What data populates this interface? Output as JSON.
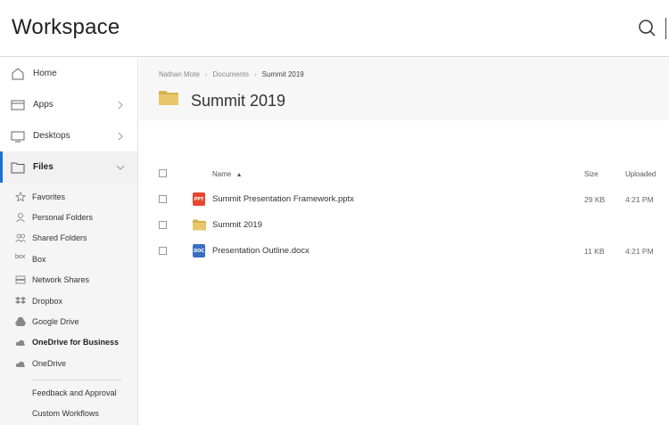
{
  "header": {
    "title": "Workspace"
  },
  "sidebar": {
    "items": [
      {
        "label": "Home",
        "icon": "home-icon"
      },
      {
        "label": "Apps",
        "icon": "apps-icon"
      },
      {
        "label": "Desktops",
        "icon": "desktop-icon"
      },
      {
        "label": "Files",
        "icon": "folder-icon"
      }
    ],
    "sub_items": [
      {
        "label": "Favorites",
        "icon": "star-icon"
      },
      {
        "label": "Personal Folders",
        "icon": "person-icon"
      },
      {
        "label": "Shared Folders",
        "icon": "people-icon"
      },
      {
        "label": "Box",
        "icon": "box-icon",
        "icon_text": "box"
      },
      {
        "label": "Network Shares",
        "icon": "server-icon"
      },
      {
        "label": "Dropbox",
        "icon": "dropbox-icon"
      },
      {
        "label": "Google Drive",
        "icon": "google-drive-icon"
      },
      {
        "label": "OneDrive for Business",
        "icon": "cloud-icon"
      },
      {
        "label": "OneDrive",
        "icon": "cloud-icon"
      },
      {
        "label": "Feedback and Approval"
      },
      {
        "label": "Custom Workflows"
      }
    ]
  },
  "main": {
    "breadcrumb": [
      "Nathan Mote",
      "Documents",
      "Summit 2019"
    ],
    "title": "Summit 2019",
    "table": {
      "columns": {
        "name": "Name",
        "size": "Size",
        "uploaded": "Uploaded"
      },
      "rows": [
        {
          "type": "pptx",
          "badge": "PPT",
          "name": "Summit Presentation Framework.pptx",
          "size": "29 KB",
          "uploaded": "4:21 PM"
        },
        {
          "type": "folder",
          "badge": "",
          "name": "Summit 2019",
          "size": "",
          "uploaded": ""
        },
        {
          "type": "docx",
          "badge": "DOC",
          "name": "Presentation Outline.docx",
          "size": "11 KB",
          "uploaded": "4:21 PM"
        }
      ]
    }
  },
  "colors": {
    "accent": "#1b6fd8",
    "ppt_badge": "#e8472f",
    "doc_badge": "#3b6fc2",
    "folder": "#e2c068"
  }
}
